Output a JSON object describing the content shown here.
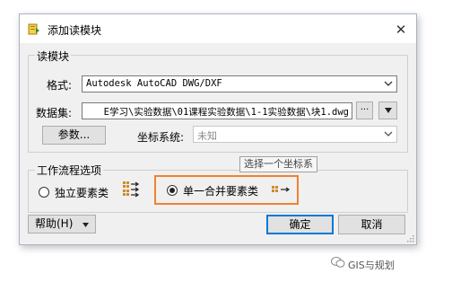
{
  "window": {
    "title": "添加读模块",
    "close_glyph": "✕"
  },
  "reader_group": {
    "title": "读模块",
    "format_label": "格式:",
    "format_value": "Autodesk AutoCAD DWG/DXF",
    "dataset_label": "数据集:",
    "dataset_value": "E学习\\实验数据\\01课程实验数据\\1-1实验数据\\块1.dwg",
    "browse_label": "···",
    "params_button": "参数...",
    "coord_label": "坐标系统:",
    "coord_value": "未知",
    "coord_tooltip": "选择一个坐标系"
  },
  "workflow_group": {
    "title": "工作流程选项",
    "option_individual": "独立要素类",
    "option_single": "单一合并要素类",
    "selected": "single",
    "highlight_color": "#f0822e"
  },
  "footer": {
    "help_label": "帮助(H)",
    "ok_label": "确定",
    "cancel_label": "取消"
  },
  "watermark": {
    "text": "GIS与规划"
  },
  "colors": {
    "dialog_bg": "#f0f0f0",
    "titlebar_bg": "#ffffff",
    "default_button_border": "#0078d7",
    "icon_gold": "#e8b000"
  }
}
